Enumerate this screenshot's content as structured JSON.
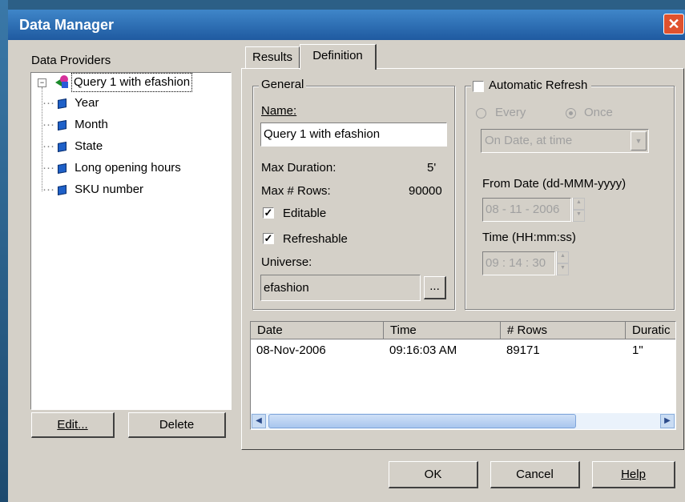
{
  "window": {
    "title": "Data Manager",
    "close_glyph": "✕"
  },
  "providers": {
    "heading": "Data Providers",
    "root": "Query 1 with efashion",
    "objects": [
      "Year",
      "Month",
      "State",
      "Long opening hours",
      "SKU number"
    ],
    "edit_label": "Edit...",
    "delete_label": "Delete"
  },
  "tabs": [
    {
      "label": "Results"
    },
    {
      "label": "Definition"
    }
  ],
  "general": {
    "heading": "General",
    "name_label": "Name:",
    "name_value": "Query 1 with efashion",
    "max_duration_label": "Max Duration:",
    "max_duration_value": "5'",
    "max_rows_label": "Max # Rows:",
    "max_rows_value": "90000",
    "editable_label": "Editable",
    "editable_checked": true,
    "refreshable_label": "Refreshable",
    "refreshable_checked": true,
    "universe_label": "Universe:",
    "universe_value": "efashion",
    "browse_label": "..."
  },
  "refresh": {
    "auto_label": "Automatic Refresh",
    "auto_checked": false,
    "every_label": "Every",
    "once_label": "Once",
    "selected": "Once",
    "mode_value": "On Date, at time",
    "from_date_label": "From Date (dd-MMM-yyyy)",
    "from_date_value": "08 - 11 - 2006",
    "time_label": "Time (HH:mm:ss)",
    "time_value": "09 : 14 : 30"
  },
  "results_table": {
    "columns": [
      "Date",
      "Time",
      "# Rows",
      "Duratic"
    ],
    "rows": [
      [
        "08-Nov-2006",
        "09:16:03 AM",
        "89171",
        "1\""
      ]
    ]
  },
  "footer": {
    "ok_label": "OK",
    "cancel_label": "Cancel",
    "help_label": "Help"
  },
  "colors": {
    "title_bar": "#2f6fb5",
    "dialog": "#d4d0c8",
    "accent": "#0a246a"
  }
}
